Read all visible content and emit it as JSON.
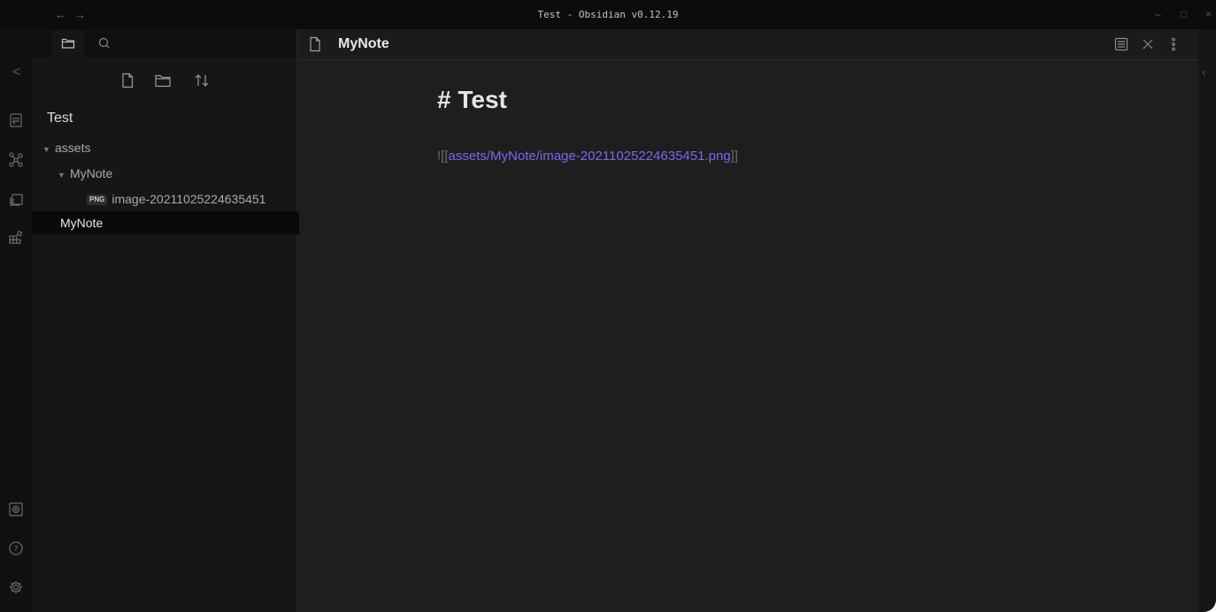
{
  "window": {
    "title": "Test - Obsidian v0.12.19",
    "nav_back": "←",
    "nav_forward": "→",
    "minimize": "–",
    "maximize": "□",
    "close": "×"
  },
  "ribbon": {
    "collapse_glyph": "<",
    "icons": [
      "open-quick-switcher-icon",
      "graph-view-icon",
      "slides-icon",
      "command-palette-icon",
      "open-vault-icon",
      "help-icon",
      "settings-icon"
    ],
    "help_glyph": "?"
  },
  "sidebar": {
    "tabs": [
      "file-explorer-tab",
      "search-tab"
    ],
    "toolbar": [
      "new-note-icon",
      "new-folder-icon",
      "sort-icon"
    ],
    "vault_name": "Test",
    "tree": [
      {
        "label": "assets",
        "arrow": "▼"
      },
      {
        "label": "MyNote",
        "arrow": "▼"
      },
      {
        "label": "image-20211025224635451",
        "badge": "PNG"
      },
      {
        "label": "MyNote",
        "active": true
      }
    ]
  },
  "main": {
    "tab_title": "MyNote",
    "heading": "# Test",
    "embed": {
      "prefix": "![[",
      "link": "assets/MyNote/image-20211025224635451.png",
      "suffix": "]]"
    }
  },
  "colors": {
    "accent_link": "#7b68ee",
    "background": "#1e1e1e",
    "sidebar": "#161616"
  }
}
